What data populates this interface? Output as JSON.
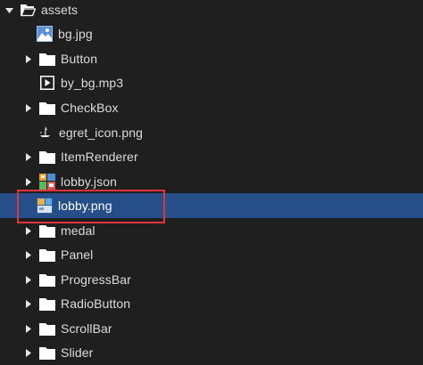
{
  "tree": {
    "root": {
      "label": "assets",
      "icon": "folder-open-icon",
      "expanded": true
    },
    "items": [
      {
        "label": "bg.jpg",
        "type": "image-file",
        "icon": "image-file-icon"
      },
      {
        "label": "Button",
        "type": "folder",
        "icon": "folder-icon",
        "expanded": false
      },
      {
        "label": "by_bg.mp3",
        "type": "audio-file",
        "icon": "media-play-icon"
      },
      {
        "label": "CheckBox",
        "type": "folder",
        "icon": "folder-icon",
        "expanded": false
      },
      {
        "label": "egret_icon.png",
        "type": "image-file",
        "icon": "small-image-icon"
      },
      {
        "label": "ItemRenderer",
        "type": "folder",
        "icon": "folder-icon",
        "expanded": false
      },
      {
        "label": "lobby.json",
        "type": "sprite-sheet",
        "icon": "sprite-sheet-icon",
        "expanded": false
      },
      {
        "label": "lobby.png",
        "type": "image-file",
        "icon": "image-file-icon",
        "selected": true
      },
      {
        "label": "medal",
        "type": "folder",
        "icon": "folder-icon",
        "expanded": false
      },
      {
        "label": "Panel",
        "type": "folder",
        "icon": "folder-icon",
        "expanded": false
      },
      {
        "label": "ProgressBar",
        "type": "folder",
        "icon": "folder-icon",
        "expanded": false
      },
      {
        "label": "RadioButton",
        "type": "folder",
        "icon": "folder-icon",
        "expanded": false
      },
      {
        "label": "ScrollBar",
        "type": "folder",
        "icon": "folder-icon",
        "expanded": false
      },
      {
        "label": "Slider",
        "type": "folder",
        "icon": "folder-icon",
        "expanded": false
      }
    ]
  },
  "colors": {
    "background": "#1f1f1f",
    "selection": "#264f8a",
    "highlight_border": "#e0343a",
    "text": "#dcdcdc"
  }
}
